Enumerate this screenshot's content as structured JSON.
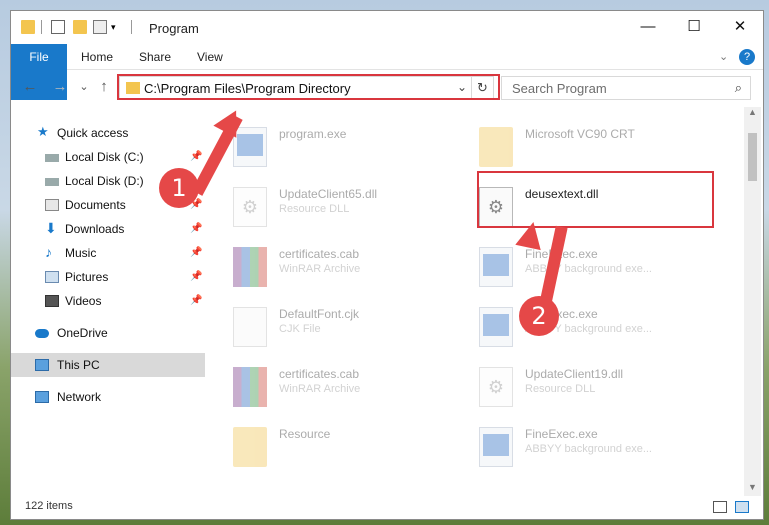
{
  "window": {
    "title": "Program"
  },
  "window_controls": {
    "minimize": "—",
    "maximize": "☐",
    "close": "✕"
  },
  "ribbon": {
    "tabs": [
      "File",
      "Home",
      "Share",
      "View"
    ],
    "help": "?"
  },
  "nav": {
    "back": "←",
    "forward": "→",
    "recent": "⌄",
    "up": "↑"
  },
  "address": {
    "path": "C:\\Program Files\\Program Directory"
  },
  "search": {
    "placeholder": "Search Program",
    "icon": "⌕"
  },
  "sidebar": {
    "items": [
      {
        "label": "Quick access",
        "icon": "star-icon"
      },
      {
        "label": "Local Disk (C:)",
        "icon": "drive-icon",
        "pin": "📌"
      },
      {
        "label": "Local Disk (D:)",
        "icon": "drive-icon"
      },
      {
        "label": "Documents",
        "icon": "documents-icon",
        "pin": "📌"
      },
      {
        "label": "Downloads",
        "icon": "download-icon",
        "pin": "📌"
      },
      {
        "label": "Music",
        "icon": "music-icon",
        "pin": "📌"
      },
      {
        "label": "Pictures",
        "icon": "pictures-icon",
        "pin": "📌"
      },
      {
        "label": "Videos",
        "icon": "videos-icon",
        "pin": "📌"
      },
      {
        "label": "OneDrive",
        "icon": "cloud-icon"
      },
      {
        "label": "This PC",
        "icon": "computer-icon"
      },
      {
        "label": "Network",
        "icon": "network-icon"
      }
    ]
  },
  "files": [
    {
      "name": "program.exe",
      "type": ""
    },
    {
      "name": "Microsoft VC90 CRT",
      "type": ""
    },
    {
      "name": "UpdateClient65.dll",
      "type": "Resource DLL"
    },
    {
      "name": "deusextext.dll",
      "type": ""
    },
    {
      "name": "certificates.cab",
      "type": "WinRAR Archive"
    },
    {
      "name": "FineExec.exe",
      "type": "ABBYY background exe..."
    },
    {
      "name": "DefaultFont.cjk",
      "type": "CJK File"
    },
    {
      "name": "FineExec.exe",
      "type": "ABBYY background exe..."
    },
    {
      "name": "certificates.cab",
      "type": "WinRAR Archive"
    },
    {
      "name": "UpdateClient19.dll",
      "type": "Resource DLL"
    },
    {
      "name": "Resource",
      "type": ""
    },
    {
      "name": "FineExec.exe",
      "type": "ABBYY background exe..."
    }
  ],
  "status": {
    "count": "122 items"
  },
  "annotations": {
    "badge1": "1",
    "badge2": "2"
  },
  "colors": {
    "accent": "#1979ca",
    "highlight": "#d9363e",
    "arrow": "#e54848"
  }
}
